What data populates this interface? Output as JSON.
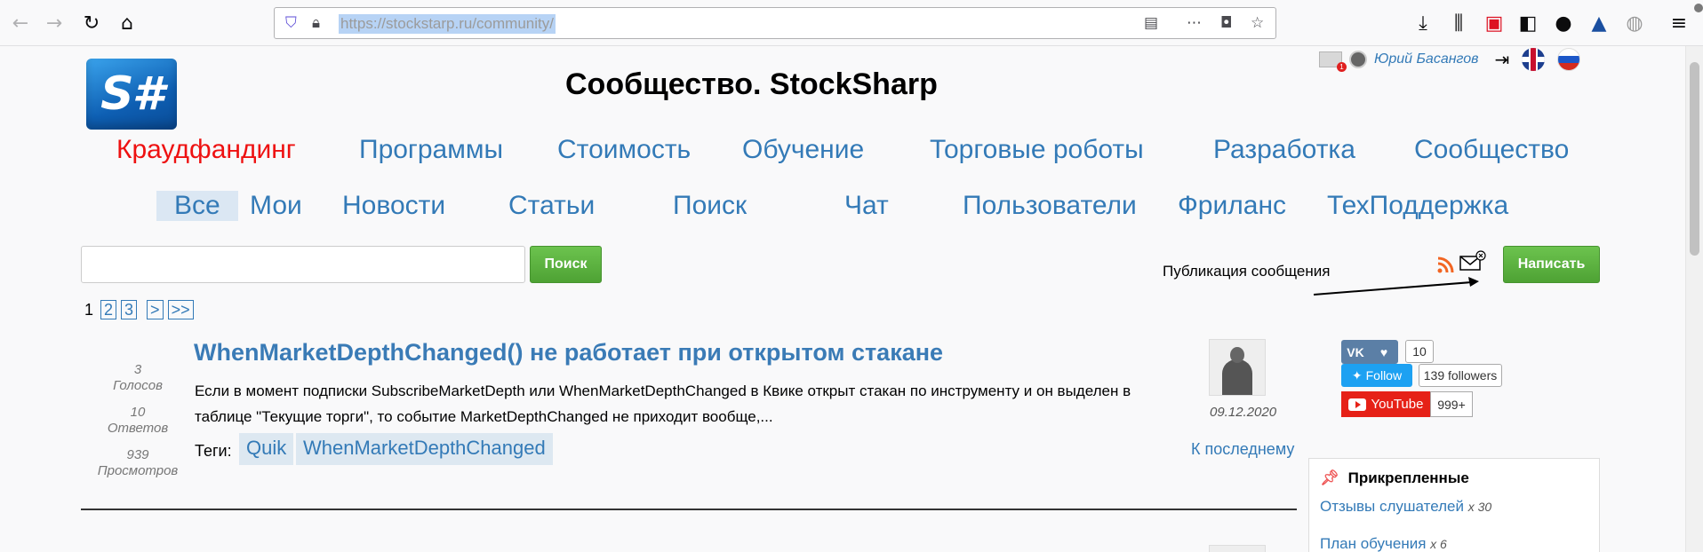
{
  "browser": {
    "url": "https://stockstarp.ru/community/",
    "icons": [
      "back-icon",
      "forward-icon",
      "reload-icon",
      "home-icon",
      "shield-icon",
      "lock-icon",
      "reader-icon",
      "more-icon",
      "pocket-icon",
      "star-icon",
      "download-icon",
      "library-icon",
      "extension-icon",
      "sidebar-icon",
      "account-icon",
      "vpn-icon",
      "globe-icon",
      "menu-icon"
    ]
  },
  "header": {
    "logo_text": "S#",
    "title": "Сообщество. StockSharp",
    "mail_count": "1",
    "user_name": "Юрий Басангов"
  },
  "menu_main": [
    {
      "label": "Краудфандинг",
      "accent": "#ee1111"
    },
    {
      "label": "Программы"
    },
    {
      "label": "Стоимость"
    },
    {
      "label": "Обучение"
    },
    {
      "label": "Торговые роботы"
    },
    {
      "label": "Разработка"
    },
    {
      "label": "Сообщество"
    }
  ],
  "menu_sub": [
    {
      "label": "Все"
    },
    {
      "label": "Мои"
    },
    {
      "label": "Новости"
    },
    {
      "label": "Статьи"
    },
    {
      "label": "Поиск"
    },
    {
      "label": "Чат"
    },
    {
      "label": "Пользователи"
    },
    {
      "label": "Фриланс"
    },
    {
      "label": "ТехПоддержка"
    }
  ],
  "search": {
    "button": "Поиск",
    "value": ""
  },
  "publish": {
    "annotation": "Публикация сообщения",
    "button": "Написать"
  },
  "pager": {
    "current": "1",
    "pages": [
      "2",
      "3",
      ">",
      ">>"
    ]
  },
  "post": {
    "votes": "3",
    "votes_label": "Голосов",
    "answers": "10",
    "answers_label": "Ответов",
    "views": "939",
    "views_label": "Просмотров",
    "title": "WhenMarketDepthChanged() не работает при открытом стакане",
    "body": "Если в момент подписки SubscribeMarketDepth или WhenMarketDepthChanged в Квике открыт стакан по инструменту и он выделен в таблице \"Текущие торги\", то событие MarketDepthChanged не приходит вообще,...",
    "tags_label": "Теги:",
    "tags": [
      "Quik",
      "WhenMarketDepthChanged"
    ],
    "date": "09.12.2020",
    "to_last": "К последнему"
  },
  "social": {
    "vk_count": "10",
    "twitter_label": "Follow",
    "twitter_followers": "139 followers",
    "youtube_label": "YouTube",
    "youtube_count": "999+"
  },
  "pinned": {
    "title": "Прикрепленные",
    "items": [
      {
        "label": "Отзывы слушателей",
        "count": "x 30"
      },
      {
        "label": "План обучения",
        "count": "x 6"
      }
    ]
  }
}
